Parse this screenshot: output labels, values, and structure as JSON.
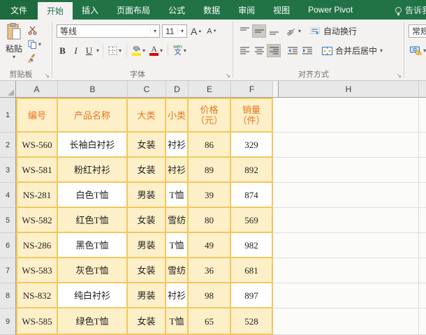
{
  "tabs": {
    "file": "文件",
    "items": [
      {
        "label": "开始",
        "selected": true
      },
      {
        "label": "插入"
      },
      {
        "label": "页面布局"
      },
      {
        "label": "公式"
      },
      {
        "label": "数据"
      },
      {
        "label": "审阅"
      },
      {
        "label": "视图"
      },
      {
        "label": "Power Pivot"
      }
    ],
    "tell_me": "告诉我"
  },
  "ribbon": {
    "clipboard": {
      "group_label": "剪贴板",
      "paste_label": "粘贴"
    },
    "font": {
      "group_label": "字体",
      "font_name": "等线",
      "font_size": "11",
      "increase_font_label": "A",
      "decrease_font_label": "A",
      "bold_label": "B",
      "italic_label": "I",
      "underline_label": "U",
      "font_color_label": "A",
      "phonetic_top": "wén",
      "phonetic_char": "文"
    },
    "alignment": {
      "group_label": "对齐方式",
      "wrap_text_label": "自动换行",
      "merge_center_label": "合并后居中"
    },
    "number": {
      "format_value": "常规"
    }
  },
  "glyphs": {
    "dropdown": "▾",
    "increase_caret": "▲",
    "decrease_caret": "▼",
    "dialog_launcher": "↘"
  },
  "icons": [
    "lightbulb-icon",
    "paste-clipboard-icon",
    "scissors-icon",
    "copy-icon",
    "format-painter-icon",
    "borders-icon",
    "fill-color-icon",
    "font-color-icon",
    "phonetic-guide-icon",
    "align-top-icon",
    "align-middle-icon",
    "align-bottom-icon",
    "orientation-icon",
    "align-left-icon",
    "align-center-icon",
    "align-right-icon",
    "decrease-indent-icon",
    "increase-indent-icon",
    "wrap-text-icon",
    "merge-center-icon",
    "accounting-format-icon",
    "select-all-corner",
    "dialog-launcher-icon"
  ],
  "colors": {
    "excel_green": "#217346",
    "ribbon_bg": "#f3f2f1",
    "table_border_gold": "#f2c75e",
    "table_fill_yellow": "#fdf0c9",
    "table_fill_white": "#ffffff",
    "table_header_orange": "#e5751e",
    "fill_swatch_yellow": "#ffe800",
    "font_color_swatch_red": "#e00000"
  },
  "sheet": {
    "col_letters": [
      "A",
      "B",
      "C",
      "D",
      "E",
      "F",
      "H"
    ],
    "row_numbers": [
      "1",
      "2",
      "3",
      "4",
      "5",
      "6",
      "7",
      "8",
      "9"
    ],
    "header_row": [
      [
        "编号"
      ],
      [
        "产品名称"
      ],
      [
        "大类"
      ],
      [
        "小类"
      ],
      [
        "价格",
        "（元）"
      ],
      [
        "销量",
        "（件）"
      ]
    ],
    "data_rows": [
      {
        "cells": [
          "WS-560",
          "长袖白衬衫",
          "女装",
          "衬衫",
          "86",
          "329"
        ],
        "white": [
          1,
          3,
          5
        ]
      },
      {
        "cells": [
          "WS-581",
          "粉红衬衫",
          "女装",
          "衬衫",
          "89",
          "892"
        ],
        "white": []
      },
      {
        "cells": [
          "NS-281",
          "白色T恤",
          "男装",
          "T恤",
          "39",
          "874"
        ],
        "white": [
          1,
          3,
          5
        ]
      },
      {
        "cells": [
          "WS-582",
          "红色T恤",
          "女装",
          "雪纺",
          "80",
          "569"
        ],
        "white": []
      },
      {
        "cells": [
          "NS-286",
          "黑色T恤",
          "男装",
          "T恤",
          "49",
          "982"
        ],
        "white": [
          1,
          3,
          5
        ]
      },
      {
        "cells": [
          "WS-583",
          "灰色T恤",
          "女装",
          "雪纺",
          "36",
          "681"
        ],
        "white": []
      },
      {
        "cells": [
          "NS-832",
          "纯白衬衫",
          "男装",
          "衬衫",
          "98",
          "897"
        ],
        "white": [
          1,
          3,
          5
        ]
      },
      {
        "cells": [
          "WS-585",
          "绿色T恤",
          "女装",
          "T恤",
          "65",
          "528"
        ],
        "white": []
      }
    ]
  }
}
